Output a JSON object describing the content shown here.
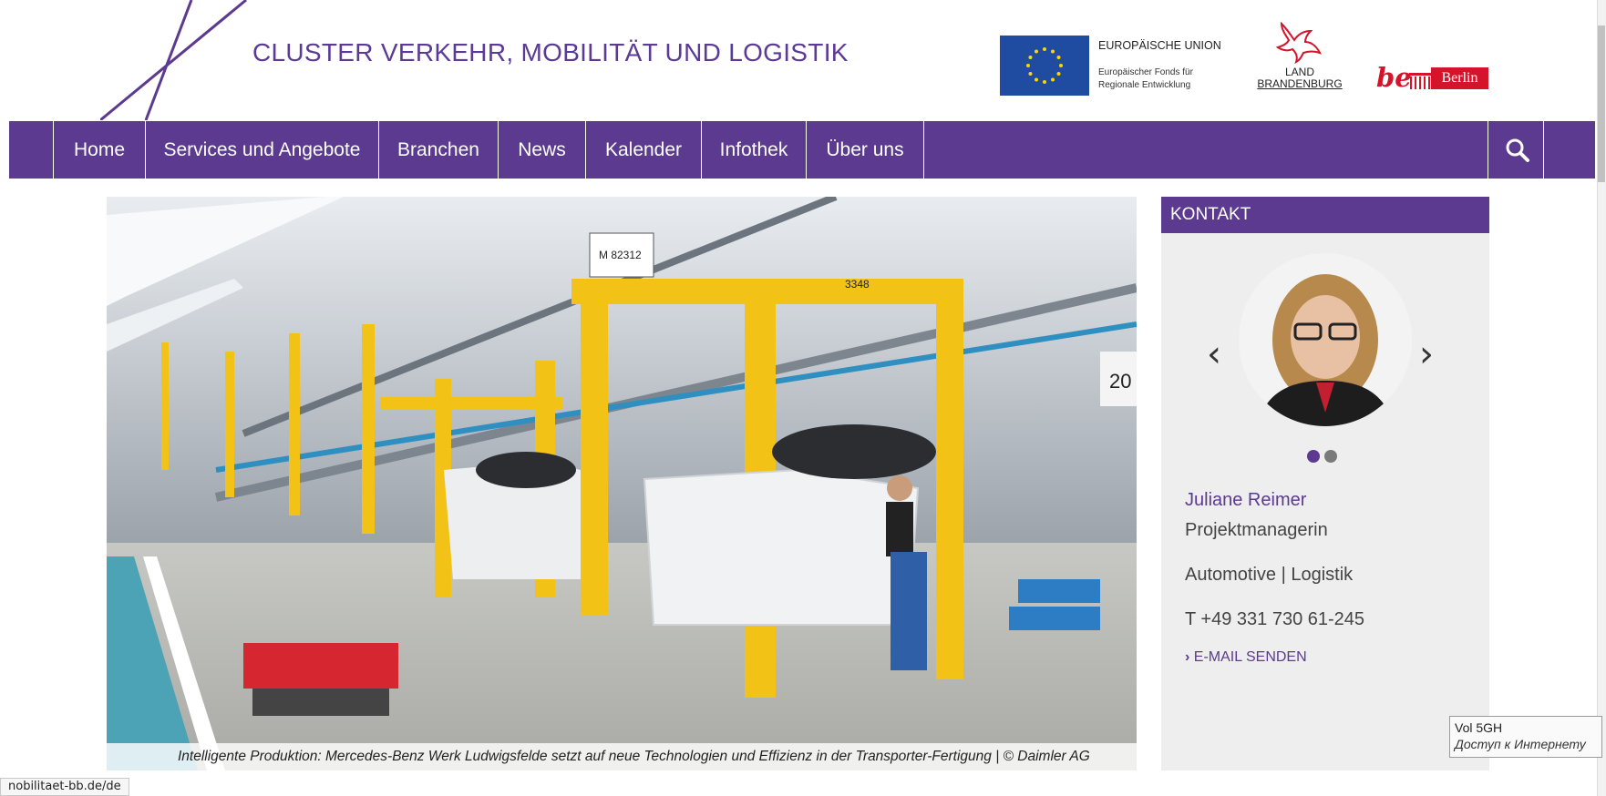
{
  "header": {
    "title": "CLUSTER VERKEHR, MOBILITÄT UND LOGISTIK",
    "eu": {
      "title": "EUROPÄISCHE UNION",
      "line1": "Europäischer Fonds für",
      "line2": "Regionale Entwicklung"
    },
    "brandenburg": {
      "line1": "LAND",
      "line2": "BRANDENBURG"
    },
    "berlin": {
      "prefix": "be",
      "box": "Berlin"
    }
  },
  "nav": {
    "items": [
      "Home",
      "Services und Angebote",
      "Branchen",
      "News",
      "Kalender",
      "Infothek",
      "Über uns"
    ],
    "search_icon": "search-icon"
  },
  "hero": {
    "caption": "Intelligente Produktion: Mercedes-Benz Werk Ludwigsfelde setzt auf neue Technologien und Effizienz in der Transporter-Fertigung | © Daimler AG",
    "sign1": "M 82312",
    "sign2": "3348",
    "sign3": "20"
  },
  "contact": {
    "header": "KONTAKT",
    "name": "Juliane Reimer",
    "role": "Projektmanagerin",
    "area": "Automotive | Logistik",
    "phone": "T +49 331 730 61-245",
    "email_link": "E-MAIL SENDEN",
    "slides": 2,
    "active_slide": 1
  },
  "browser": {
    "status_url": "nobilitaet-bb.de/de",
    "tooltip_line1": "Vol 5GH",
    "tooltip_line2": "Доступ к Интернету"
  },
  "colors": {
    "brand_purple": "#5b3a8f",
    "eu_blue": "#1f4ba1",
    "berlin_red": "#d4142a"
  }
}
